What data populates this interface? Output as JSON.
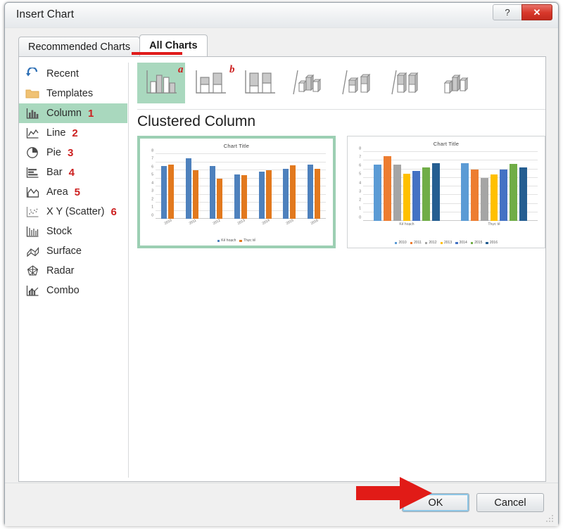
{
  "window": {
    "title": "Insert Chart",
    "help_label": "?",
    "close_label": "✕"
  },
  "tabs": [
    {
      "label": "Recommended Charts",
      "active": false
    },
    {
      "label": "All Charts",
      "active": true
    }
  ],
  "sidebar": {
    "items": [
      {
        "label": "Recent",
        "icon": "recent-icon",
        "num": "",
        "selected": false
      },
      {
        "label": "Templates",
        "icon": "folder-icon",
        "num": "",
        "selected": false
      },
      {
        "label": "Column",
        "icon": "column-icon",
        "num": "1",
        "selected": true
      },
      {
        "label": "Line",
        "icon": "line-icon",
        "num": "2",
        "selected": false
      },
      {
        "label": "Pie",
        "icon": "pie-icon",
        "num": "3",
        "selected": false
      },
      {
        "label": "Bar",
        "icon": "bar-icon",
        "num": "4",
        "selected": false
      },
      {
        "label": "Area",
        "icon": "area-icon",
        "num": "5",
        "selected": false
      },
      {
        "label": "X Y (Scatter)",
        "icon": "scatter-icon",
        "num": "6",
        "selected": false
      },
      {
        "label": "Stock",
        "icon": "stock-icon",
        "num": "",
        "selected": false
      },
      {
        "label": "Surface",
        "icon": "surface-icon",
        "num": "",
        "selected": false
      },
      {
        "label": "Radar",
        "icon": "radar-icon",
        "num": "",
        "selected": false
      },
      {
        "label": "Combo",
        "icon": "combo-icon",
        "num": "",
        "selected": false
      }
    ]
  },
  "gallery": {
    "annotations": [
      {
        "letter": "a",
        "for": "clustered-column"
      },
      {
        "letter": "b",
        "for": "stacked-column"
      }
    ],
    "items": [
      {
        "name": "clustered-column",
        "selected": true
      },
      {
        "name": "stacked-column",
        "selected": false
      },
      {
        "name": "100-percent-stacked-column",
        "selected": false
      },
      {
        "name": "3d-clustered-column",
        "selected": false
      },
      {
        "name": "3d-stacked-column",
        "selected": false
      },
      {
        "name": "3d-100-percent-stacked-column",
        "selected": false
      },
      {
        "name": "3d-column",
        "selected": false
      }
    ]
  },
  "section": {
    "title": "Clustered Column"
  },
  "footer": {
    "ok_label": "OK",
    "cancel_label": "Cancel"
  },
  "colors": {
    "selection_green": "#a9d8be",
    "annotation_red": "#cc1f1f",
    "arrow_red": "#e11b17",
    "series_blue": "#4e81bd",
    "series_orange": "#e2791e",
    "palette": [
      "#5b9bd5",
      "#ed7d31",
      "#a5a5a5",
      "#ffc000",
      "#4472c4",
      "#70ad47",
      "#255e91"
    ]
  },
  "chart_data": [
    {
      "id": "preview-clustered-column",
      "type": "bar",
      "title": "Chart Title",
      "xlabel": "",
      "ylabel": "",
      "ylim": [
        0,
        8
      ],
      "yticks": [
        0,
        1,
        2,
        3,
        4,
        5,
        6,
        7,
        8
      ],
      "grid": true,
      "legend_position": "bottom",
      "categories": [
        "2010",
        "2011",
        "2012",
        "2013",
        "2014",
        "2015",
        "2016"
      ],
      "series": [
        {
          "name": "Kế hoạch",
          "color": "#4e81bd",
          "values": [
            6.5,
            7.5,
            6.5,
            5.5,
            5.8,
            6.2,
            6.7
          ]
        },
        {
          "name": "Thực tế",
          "color": "#e2791e",
          "values": [
            6.7,
            6.0,
            5.0,
            5.4,
            6.0,
            6.6,
            6.2
          ]
        }
      ]
    },
    {
      "id": "preview-clustered-column-switched",
      "type": "bar",
      "title": "Chart Title",
      "xlabel": "",
      "ylabel": "",
      "ylim": [
        0,
        8
      ],
      "yticks": [
        0,
        1,
        2,
        3,
        4,
        5,
        6,
        7,
        8
      ],
      "grid": true,
      "legend_position": "bottom",
      "categories": [
        "Kế hoạch",
        "Thực tế"
      ],
      "series": [
        {
          "name": "2010",
          "color": "#5b9bd5",
          "values": [
            6.5,
            6.7
          ]
        },
        {
          "name": "2011",
          "color": "#ed7d31",
          "values": [
            7.5,
            6.0
          ]
        },
        {
          "name": "2012",
          "color": "#a5a5a5",
          "values": [
            6.5,
            5.0
          ]
        },
        {
          "name": "2013",
          "color": "#ffc000",
          "values": [
            5.5,
            5.4
          ]
        },
        {
          "name": "2014",
          "color": "#4472c4",
          "values": [
            5.8,
            6.0
          ]
        },
        {
          "name": "2015",
          "color": "#70ad47",
          "values": [
            6.2,
            6.6
          ]
        },
        {
          "name": "2016",
          "color": "#255e91",
          "values": [
            6.7,
            6.2
          ]
        }
      ]
    }
  ]
}
